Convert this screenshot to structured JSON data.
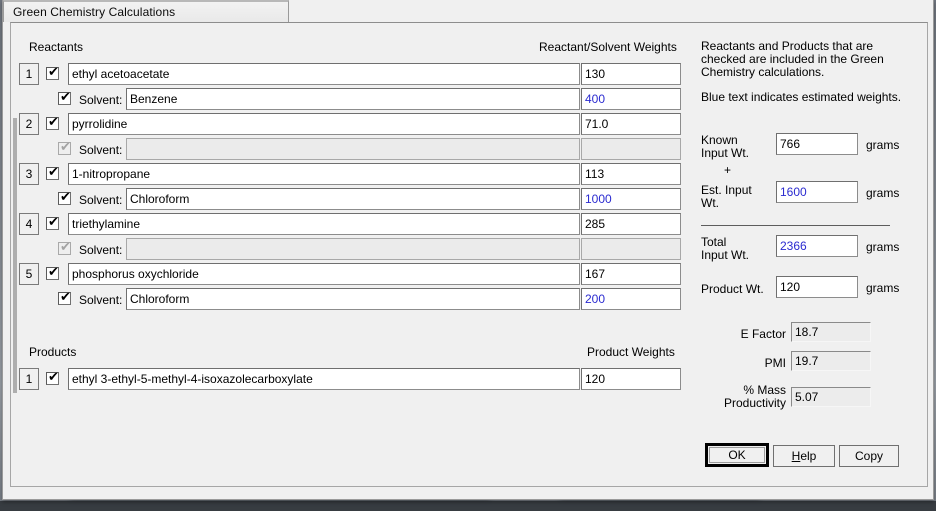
{
  "window": {
    "title": "Green Chemistry Calculations"
  },
  "headers": {
    "reactants": "Reactants",
    "reactant_weights": "Reactant/Solvent Weights",
    "products": "Products",
    "product_weights": "Product Weights",
    "solvent_label": "Solvent:"
  },
  "reactants": [
    {
      "index": "1",
      "checked": true,
      "name": "ethyl acetoacetate",
      "weight": "130",
      "weight_estimated": false,
      "solvent": {
        "checked": true,
        "enabled": true,
        "name": "Benzene",
        "weight": "400",
        "weight_estimated": true
      }
    },
    {
      "index": "2",
      "checked": true,
      "name": "pyrrolidine",
      "weight": "71.0",
      "weight_estimated": false,
      "solvent": {
        "checked": true,
        "enabled": false,
        "name": "",
        "weight": "",
        "weight_estimated": false
      }
    },
    {
      "index": "3",
      "checked": true,
      "name": "1-nitropropane",
      "weight": "113",
      "weight_estimated": false,
      "solvent": {
        "checked": true,
        "enabled": true,
        "name": "Chloroform",
        "weight": "1000",
        "weight_estimated": true
      }
    },
    {
      "index": "4",
      "checked": true,
      "name": "triethylamine",
      "weight": "285",
      "weight_estimated": false,
      "solvent": {
        "checked": true,
        "enabled": false,
        "name": "",
        "weight": "",
        "weight_estimated": false
      }
    },
    {
      "index": "5",
      "checked": true,
      "name": "phosphorus oxychloride",
      "weight": "167",
      "weight_estimated": false,
      "solvent": {
        "checked": true,
        "enabled": true,
        "name": "Chloroform",
        "weight": "200",
        "weight_estimated": true
      }
    }
  ],
  "products": [
    {
      "index": "1",
      "checked": true,
      "name": "ethyl 3-ethyl-5-methyl-4-isoxazolecarboxylate",
      "weight": "120",
      "weight_estimated": false
    }
  ],
  "info": {
    "line1": "Reactants and Products that are",
    "line2": "checked are included in the Green",
    "line3": "Chemistry calculations.",
    "line4": "Blue text indicates estimated weights."
  },
  "summary": {
    "known_input_label_1": "Known",
    "known_input_label_2": "Input Wt.",
    "known_input_value": "766",
    "known_input_units": "grams",
    "plus": "+",
    "est_input_label_1": "Est. Input",
    "est_input_label_2": "Wt.",
    "est_input_value": "1600",
    "est_input_units": "grams",
    "total_input_label_1": "Total",
    "total_input_label_2": "Input Wt.",
    "total_input_value": "2366",
    "total_input_units": "grams",
    "product_wt_label": "Product Wt.",
    "product_wt_value": "120",
    "product_wt_units": "grams"
  },
  "metrics": {
    "e_factor_label": "E Factor",
    "e_factor_value": "18.7",
    "pmi_label": "PMI",
    "pmi_value": "19.7",
    "mass_productivity_label_1": "% Mass",
    "mass_productivity_label_2": "Productivity",
    "mass_productivity_value": "5.07"
  },
  "buttons": {
    "ok": "OK",
    "help_accel": "H",
    "help_rest": "elp",
    "copy": "Copy"
  },
  "colors": {
    "estimated_text": "#2b2bd0",
    "dialog_bg": "#f0f0f0"
  }
}
